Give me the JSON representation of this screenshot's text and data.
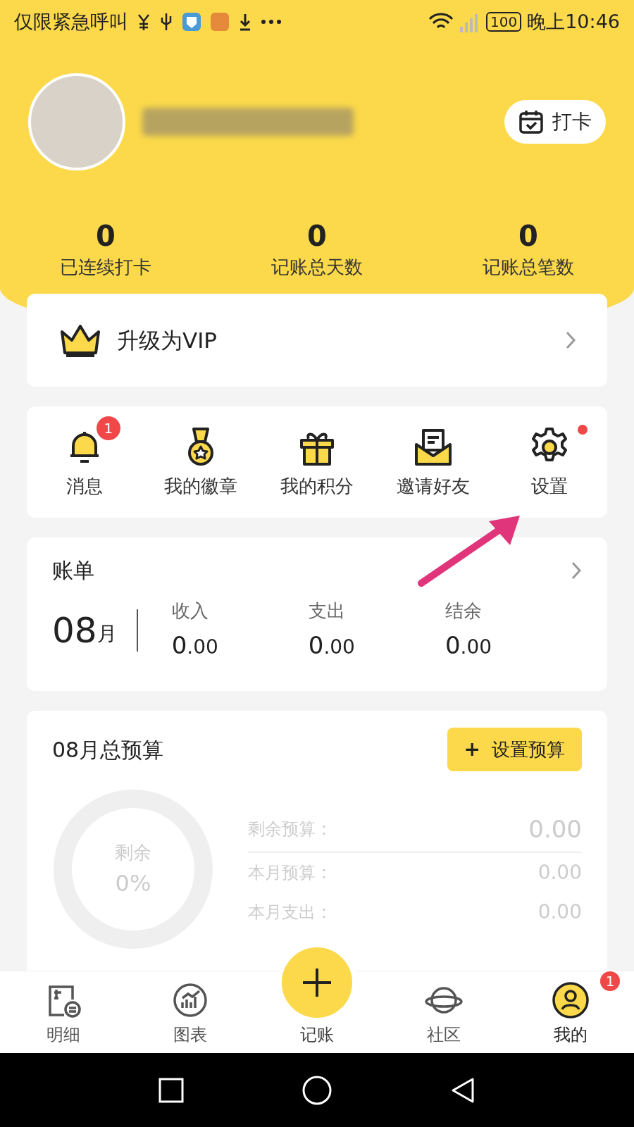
{
  "status_bar": {
    "carrier_text": "仅限紧急呼叫",
    "battery": "100",
    "time": "晚上10:46"
  },
  "profile": {
    "checkin_button": "打卡"
  },
  "stats": [
    {
      "value": "0",
      "label": "已连续打卡"
    },
    {
      "value": "0",
      "label": "记账总天数"
    },
    {
      "value": "0",
      "label": "记账总笔数"
    }
  ],
  "vip": {
    "label": "升级为VIP"
  },
  "shortcuts": [
    {
      "kind": "bell",
      "label": "消息",
      "badge": "1",
      "dot": false
    },
    {
      "kind": "medal",
      "label": "我的徽章",
      "dot": false
    },
    {
      "kind": "gift",
      "label": "我的积分",
      "dot": false
    },
    {
      "kind": "mail",
      "label": "邀请好友",
      "dot": false
    },
    {
      "kind": "gear",
      "label": "设置",
      "dot": true
    }
  ],
  "bill": {
    "title": "账单",
    "month": "08",
    "month_unit": "月",
    "items": [
      {
        "label": "收入",
        "integer": "0",
        "decimals": ".00"
      },
      {
        "label": "支出",
        "integer": "0",
        "decimals": ".00"
      },
      {
        "label": "结余",
        "integer": "0",
        "decimals": ".00"
      }
    ]
  },
  "budget": {
    "title": "08月总预算",
    "button_icon": "+",
    "button": "设置预算",
    "ring_label": "剩余",
    "ring_value": "0%",
    "rows": [
      {
        "label": "剩余预算 :",
        "value": "0.00"
      },
      {
        "label": "本月预算 :",
        "value": "0.00"
      },
      {
        "label": "本月支出 :",
        "value": "0.00"
      }
    ]
  },
  "nav": [
    {
      "kind": "ledger",
      "label": "明细",
      "selected": false
    },
    {
      "kind": "chart",
      "label": "图表",
      "selected": false
    },
    {
      "kind": "add",
      "label": "记账",
      "selected": false
    },
    {
      "kind": "planet",
      "label": "社区",
      "selected": false
    },
    {
      "kind": "user",
      "label": "我的",
      "selected": true,
      "badge": "1"
    }
  ]
}
